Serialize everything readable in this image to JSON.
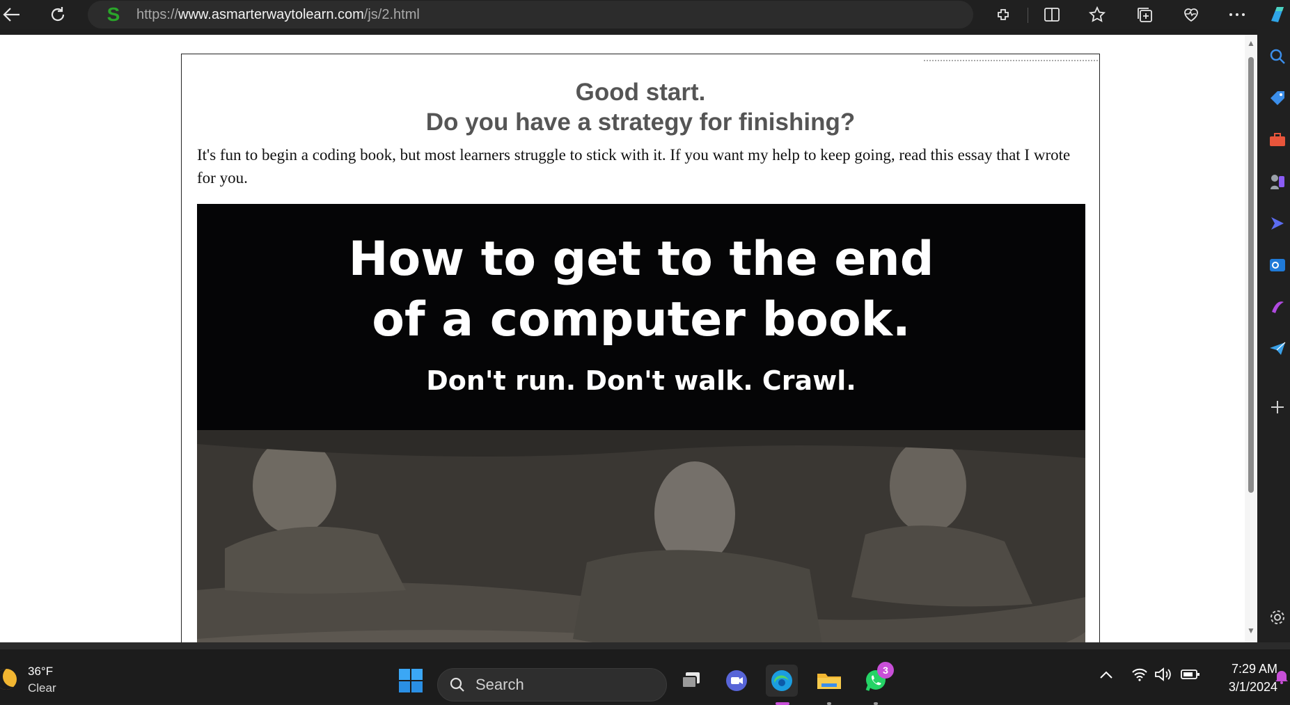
{
  "browser": {
    "url_prefix": "https://",
    "url_domain": "www.asmarterwaytolearn.com",
    "url_path": "/js/2.html"
  },
  "page": {
    "heading_line1": "Good start.",
    "heading_line2": "Do you have a strategy for finishing?",
    "intro": "It's fun to begin a coding book, but most learners struggle to stick with it. If you want my help to keep going, read this essay that I wrote for you.",
    "banner": {
      "line1": "How to get to the end",
      "line2": "of a computer book.",
      "line3": "Don't run. Don't walk. Crawl."
    }
  },
  "taskbar": {
    "weather_temp": "36°F",
    "weather_condition": "Clear",
    "search_label": "Search",
    "whatsapp_badge": "3",
    "time": "7:29 AM",
    "date": "3/1/2024"
  },
  "colors": {
    "heading": "#555555",
    "banner_bg": "#050506",
    "site_icon": "#2aa52a",
    "accent_blue": "#3b8eea"
  }
}
